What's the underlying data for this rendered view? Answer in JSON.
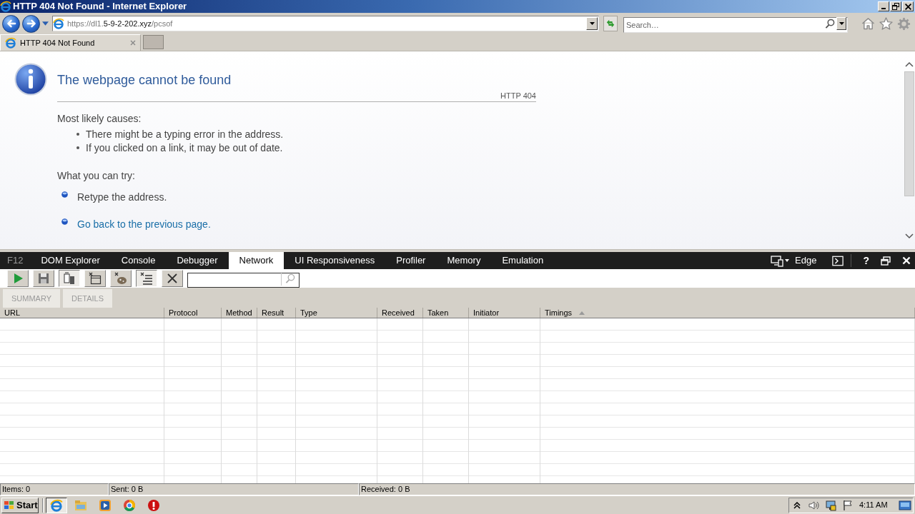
{
  "window": {
    "title": "HTTP 404 Not Found - Internet Explorer"
  },
  "address_bar": {
    "url": [
      {
        "text": "https://dl1.",
        "emphasized": false
      },
      {
        "text": "5-9-2-202.xyz",
        "emphasized": true
      },
      {
        "text": "/pcsof",
        "emphasized": false
      }
    ]
  },
  "search": {
    "placeholder": "Search…"
  },
  "tabs": [
    {
      "label": "HTTP 404 Not Found",
      "selected": true
    }
  ],
  "page": {
    "title": "The webpage cannot be found",
    "code": "HTTP 404",
    "causes_heading": "Most likely causes:",
    "causes": [
      "There might be a typing error in the address.",
      "If you clicked on a link, it may be out of date."
    ],
    "try_heading": "What you can try:",
    "actions": [
      {
        "kind": "text",
        "text": "Retype the address."
      },
      {
        "kind": "link",
        "text": "Go back to the previous page."
      }
    ]
  },
  "devtools": {
    "label": "F12",
    "tabs": [
      {
        "label": "DOM Explorer",
        "selected": false
      },
      {
        "label": "Console",
        "selected": false
      },
      {
        "label": "Debugger",
        "selected": false
      },
      {
        "label": "Network",
        "selected": true
      },
      {
        "label": "UI Responsiveness",
        "selected": false
      },
      {
        "label": "Profiler",
        "selected": false
      },
      {
        "label": "Memory",
        "selected": false
      },
      {
        "label": "Emulation",
        "selected": false
      }
    ],
    "emulation": "Edge",
    "help": "?",
    "toolbar": [
      {
        "kind": "start",
        "pressed": false
      },
      {
        "kind": "export",
        "pressed": false
      },
      {
        "kind": "clear-on-navigate",
        "pressed": true
      },
      {
        "kind": "clear-cache",
        "pressed": false
      },
      {
        "kind": "clear-cookies",
        "pressed": false
      },
      {
        "kind": "filter",
        "pressed": true
      },
      {
        "kind": "clear",
        "pressed": false
      }
    ],
    "views": [
      {
        "label": "SUMMARY"
      },
      {
        "label": "DETAILS"
      }
    ]
  },
  "table": {
    "columns": [
      {
        "label": "URL",
        "sorted": false
      },
      {
        "label": "Protocol",
        "sorted": false
      },
      {
        "label": "Method",
        "sorted": false
      },
      {
        "label": "Result",
        "sorted": false
      },
      {
        "label": "Type",
        "sorted": false
      },
      {
        "label": "Received",
        "sorted": false
      },
      {
        "label": "Taken",
        "sorted": false
      },
      {
        "label": "Initiator",
        "sorted": false
      },
      {
        "label": "Timings",
        "sorted": true
      }
    ]
  },
  "status_bar": [
    "Items: 0",
    "Sent: 0 B",
    "Received: 0 B"
  ],
  "taskbar": {
    "start": "Start",
    "apps": [
      {
        "kind": "browser",
        "selected": true
      },
      {
        "kind": "folder",
        "selected": false
      },
      {
        "kind": "media",
        "selected": false
      },
      {
        "kind": "ball",
        "selected": false
      },
      {
        "kind": "alert",
        "selected": false
      }
    ],
    "clock": "4:11 AM"
  }
}
